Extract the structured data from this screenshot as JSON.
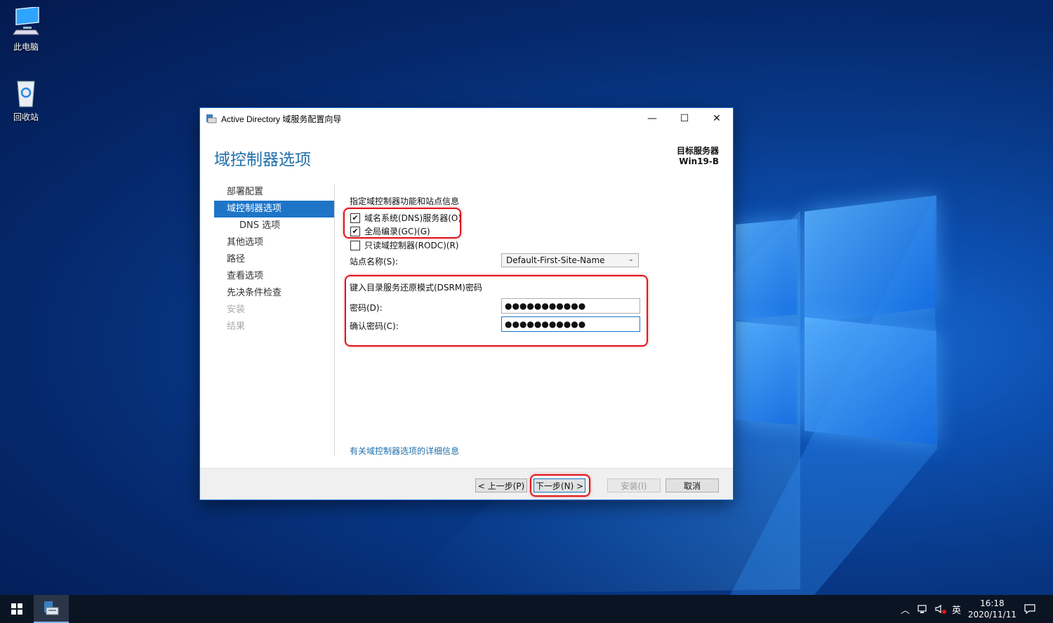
{
  "desktop": {
    "icons": [
      {
        "label": "此电脑"
      },
      {
        "label": "回收站"
      }
    ]
  },
  "window": {
    "title": "Active Directory 域服务配置向导",
    "controls": {
      "minimize": "—",
      "maximize": "☐",
      "close": "✕"
    },
    "page_title": "域控制器选项",
    "target_server_label": "目标服务器",
    "target_server_name": "Win19-B"
  },
  "nav": {
    "items": [
      {
        "label": "部署配置",
        "state": "normal"
      },
      {
        "label": "域控制器选项",
        "state": "active"
      },
      {
        "label": "DNS 选项",
        "state": "sub"
      },
      {
        "label": "其他选项",
        "state": "normal"
      },
      {
        "label": "路径",
        "state": "normal"
      },
      {
        "label": "查看选项",
        "state": "normal"
      },
      {
        "label": "先决条件检查",
        "state": "normal"
      },
      {
        "label": "安装",
        "state": "disabled"
      },
      {
        "label": "结果",
        "state": "disabled"
      }
    ]
  },
  "content": {
    "section_label": "指定域控制器功能和站点信息",
    "checkboxes": [
      {
        "label": "域名系统(DNS)服务器(O)",
        "checked": true
      },
      {
        "label": "全局编录(GC)(G)",
        "checked": true
      },
      {
        "label": "只读域控制器(RODC)(R)",
        "checked": false
      }
    ],
    "site_label": "站点名称(S):",
    "site_value": "Default-First-Site-Name",
    "dsrm_label": "键入目录服务还原模式(DSRM)密码",
    "password_label": "密码(D):",
    "password_value": "●●●●●●●●●●●",
    "confirm_label": "确认密码(C):",
    "confirm_value": "●●●●●●●●●●●",
    "more_link": "有关域控制器选项的详细信息"
  },
  "footer": {
    "prev_label": "< 上一步(P)",
    "next_label": "下一步(N) >",
    "install_label": "安装(I)",
    "cancel_label": "取消"
  },
  "taskbar": {
    "ime": "英",
    "time": "16:18",
    "date": "2020/11/11"
  },
  "colors": {
    "accent": "#1e75c8",
    "title_blue": "#1e6fa8",
    "highlight_red": "#e0161c"
  }
}
